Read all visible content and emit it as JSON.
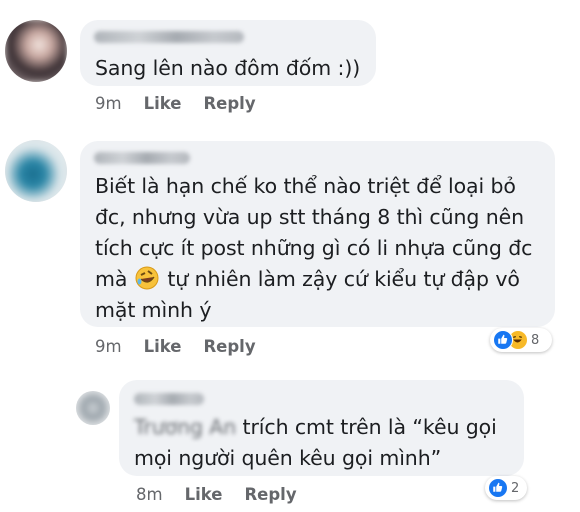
{
  "comments": [
    {
      "text_lines": [
        "Sang lên nào đôm đốm :))"
      ],
      "time": "9m",
      "like_label": "Like",
      "reply_label": "Reply",
      "reaction_count": null
    },
    {
      "text_lines": [
        "Biết là hạn chế ko thể nào triệt để loại bỏ",
        "đc, nhưng vừa up stt tháng 8 thì cũng nên",
        "tích cực ít post những gì có li nhựa cũng đc",
        "tự nhiên làm zậy cứ kiểu tự đập vô",
        "mặt mình ý"
      ],
      "line4_prefix": "mà",
      "time": "9m",
      "like_label": "Like",
      "reply_label": "Reply",
      "reaction_count": "8"
    },
    {
      "tagged_name": "Trương An",
      "text_after_tag": " trích cmt trên là “kêu gọi",
      "text_line2": "mọi người quên kêu gọi mình”",
      "time": "8m",
      "like_label": "Like",
      "reply_label": "Reply",
      "reaction_count": "2"
    }
  ],
  "icons": {
    "like": "thumbs-up-icon",
    "haha": "laughing-face-icon",
    "emoji_in_text": "rofl-emoji-icon"
  },
  "colors": {
    "bubble": "#f0f2f5",
    "meta": "#65676b",
    "like_blue": "#1877f2",
    "haha_yellow": "#f7b928"
  }
}
